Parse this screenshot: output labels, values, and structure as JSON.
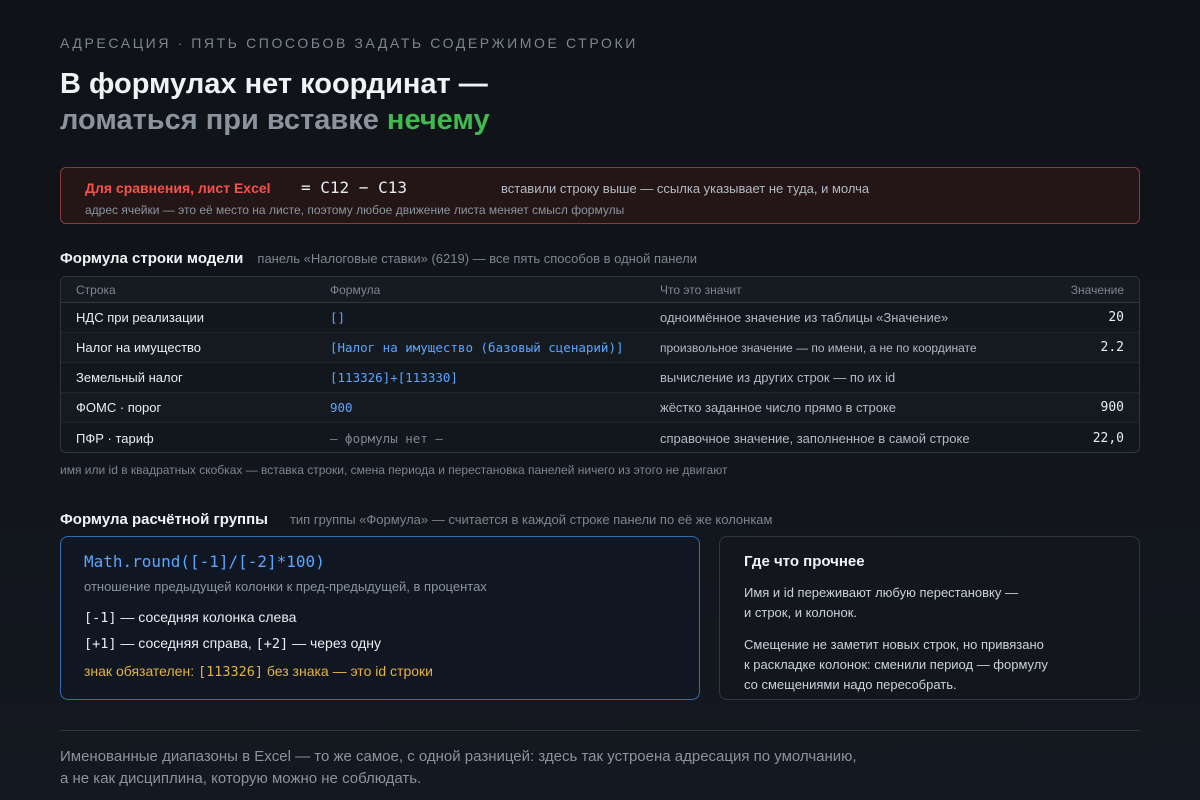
{
  "eyebrow": "АДРЕСАЦИЯ · ПЯТЬ СПОСОБОВ ЗАДАТЬ СОДЕРЖИМОЕ СТРОКИ",
  "title": {
    "line1": "В формулах нет координат —",
    "line2_prefix": "ломаться при вставке ",
    "line2_accent": "нечему"
  },
  "excel": {
    "label": "Для сравнения, лист Excel",
    "formula": "= C12 − C13",
    "description": "вставили строку выше — ссылка указывает не туда, и молча",
    "note": "адрес ячейки — это её место на листе, поэтому любое движение листа меняет смысл формулы"
  },
  "model": {
    "heading": "Формула строки модели",
    "subheading": "панель «Налоговые ставки» (6219) — все пять способов в одной панели",
    "columns": [
      "Строка",
      "Формула",
      "Что это значит",
      "Значение"
    ],
    "rows": [
      {
        "name": "НДС при реализации",
        "formula": "[]",
        "meaning": "одноимённое значение из таблицы «Значение»",
        "value": "20"
      },
      {
        "name": "Налог на имущество",
        "formula": "[Налог на имущество (базовый сценарий)]",
        "meaning": "произвольное значение — по имени, а не по координате",
        "value": "2.2"
      },
      {
        "name": "Земельный налог",
        "formula": "[113326]+[113330]",
        "meaning": "вычисление из других строк — по их id",
        "value": ""
      },
      {
        "name": "ФОМС · порог",
        "formula": "900",
        "meaning": "жёстко заданное число прямо в строке",
        "value": "900"
      },
      {
        "name": "ПФР · тариф",
        "formula": "— формулы нет —",
        "meaning": "справочное значение, заполненное в самой строке",
        "value": "22,0"
      }
    ],
    "note": "имя или id в квадратных скобках — вставка строки, смена периода и перестановка панелей ничего из этого не двигают"
  },
  "group": {
    "heading": "Формула расчётной группы",
    "subheading": "тип группы «Формула» — считается в каждой строке панели по её же колонкам",
    "formula": "Math.round([-1]/[-2]*100)",
    "description": "отношение предыдущей колонки к пред-предыдущей, в процентах",
    "line1_code": "[-1]",
    "line1_text": " — соседняя колонка слева",
    "line2_code_a": "[+1]",
    "line2_text_a": " — соседняя справа, ",
    "line2_code_b": "[+2]",
    "line2_text_b": " — через одну",
    "warn_prefix": "знак обязателен: ",
    "warn_code": "[113326]",
    "warn_suffix": " без знака — это id строки"
  },
  "side": {
    "title": "Где что прочнее",
    "p1_l1": "Имя и id переживают любую перестановку —",
    "p1_l2": "и строк, и колонок.",
    "p2_l1": "Смещение не заметит новых строк, но привязано",
    "p2_l2": "к раскладке колонок: сменили период — формулу",
    "p2_l3": "со смещениями надо пересобрать."
  },
  "footer": {
    "line1": "Именованные диапазоны в Excel — то же самое, с одной разницей: здесь так устроена адресация по умолчанию,",
    "line2": "а не как дисциплина, которую можно не соблюдать."
  }
}
